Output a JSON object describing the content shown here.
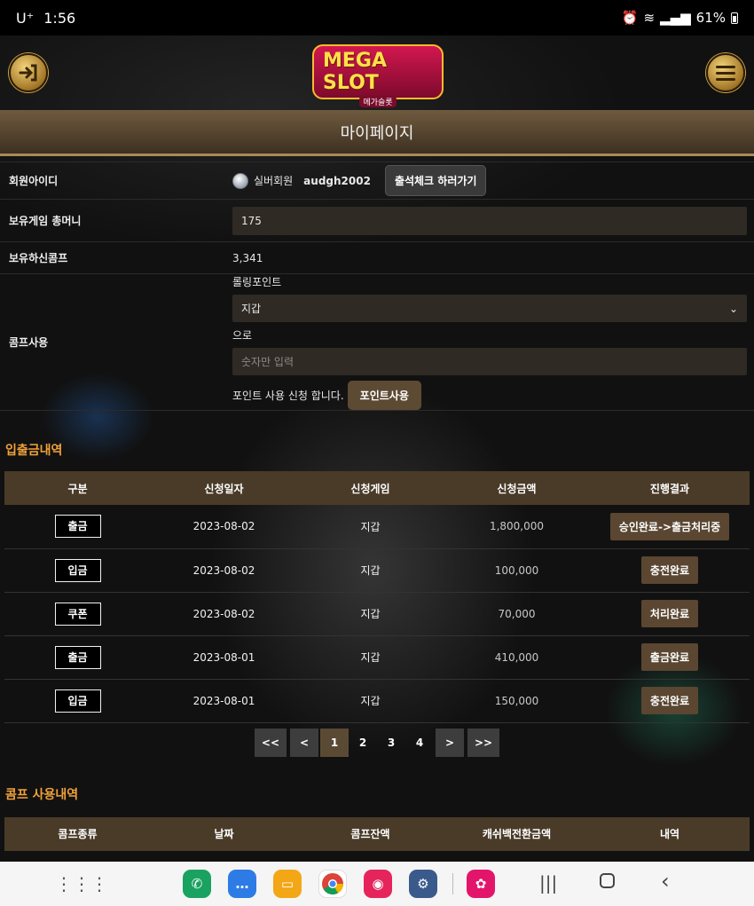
{
  "status_bar": {
    "carrier": "U⁺",
    "time": "1:56",
    "icons": [
      "alarm-icon",
      "wifi-icon",
      "signal-icon"
    ],
    "battery": "61%"
  },
  "header": {
    "logo_text": "MEGA SLOT",
    "logo_sub": "메가슬롯",
    "logout_icon": "login-arrow-icon",
    "menu_icon": "hamburger-icon"
  },
  "page_title": "마이페이지",
  "member": {
    "id_label": "회원아이디",
    "grade": "실버회원",
    "username": "audgh2002",
    "attendance_button": "출석체크 하러가기",
    "money_label": "보유게임 총머니",
    "money_value": "175",
    "comp_label": "보유하신콤프",
    "comp_value": "3,341",
    "use_label": "콤프사용",
    "rolling_label": "롤링포인트",
    "wallet_select": "지갑",
    "to_text": "으로",
    "amount_placeholder": "숫자만 입력",
    "apply_text": "포인트 사용 신청 합니다.",
    "apply_button": "포인트사용"
  },
  "transactions": {
    "title": "입출금내역",
    "columns": [
      "구분",
      "신청일자",
      "신청게임",
      "신청금액",
      "진행결과"
    ],
    "rows": [
      {
        "type": "출금",
        "date": "2023-08-02",
        "game": "지갑",
        "amount": "1,800,000",
        "result": "승인완료->출금처리중"
      },
      {
        "type": "입금",
        "date": "2023-08-02",
        "game": "지갑",
        "amount": "100,000",
        "result": "충전완료"
      },
      {
        "type": "쿠폰",
        "date": "2023-08-02",
        "game": "지갑",
        "amount": "70,000",
        "result": "처리완료"
      },
      {
        "type": "출금",
        "date": "2023-08-01",
        "game": "지갑",
        "amount": "410,000",
        "result": "출금완료"
      },
      {
        "type": "입금",
        "date": "2023-08-01",
        "game": "지갑",
        "amount": "150,000",
        "result": "충전완료"
      }
    ]
  },
  "pagination": {
    "first": "<<",
    "prev": "<",
    "pages": [
      "1",
      "2",
      "3",
      "4"
    ],
    "current": "1",
    "next": ">",
    "last": ">>"
  },
  "comp_history": {
    "title": "콤프 사용내역",
    "columns": [
      "콤프종류",
      "날짜",
      "콤프잔액",
      "캐쉬백전환금액",
      "내역"
    ]
  },
  "nav_bar": {
    "apps": [
      "apps-grid-icon",
      "phone-icon",
      "messages-icon",
      "files-icon",
      "chrome-icon",
      "camera-icon",
      "settings-icon",
      "flower-app-icon"
    ],
    "buttons": [
      "recent-apps-icon",
      "home-icon",
      "back-icon"
    ]
  }
}
